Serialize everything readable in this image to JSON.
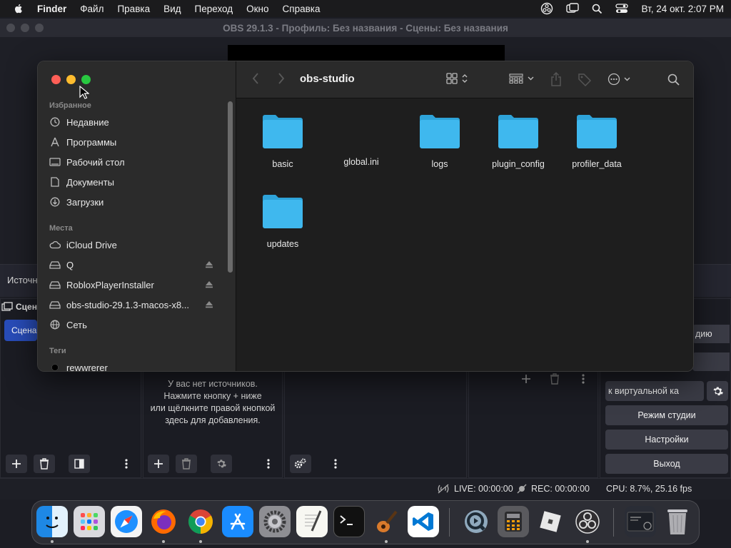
{
  "menubar": {
    "app": "Finder",
    "items": [
      "Файл",
      "Правка",
      "Вид",
      "Переход",
      "Окно",
      "Справка"
    ],
    "clock": "Вт, 24 окт.  2:07 PM"
  },
  "obs": {
    "title": "OBS 29.1.3 - Профиль: Без названия - Сцены: Без названия",
    "sources_dock_label": "Источн",
    "scenes_tab": "Сцен",
    "scene_item": "Сцена",
    "empty_sources": [
      "У вас нет источников.",
      "Нажмите кнопку + ниже",
      "или щёлкните правой кнопкой",
      "здесь для добавления."
    ],
    "controls": {
      "partial_1": "дию",
      "partial_2": "",
      "virtual_cam": "к виртуальной ка",
      "studio_mode": "Режим студии",
      "settings": "Настройки",
      "exit": "Выход"
    },
    "status": {
      "live": "LIVE: 00:00:00",
      "rec": "REC: 00:00:00",
      "cpu": "CPU: 8.7%, 25.16 fps"
    }
  },
  "finder": {
    "folder_title": "obs-studio",
    "sidebar": {
      "favorites_header": "Избранное",
      "favorites": [
        {
          "label": "Недавние",
          "icon": "clock-icon"
        },
        {
          "label": "Программы",
          "icon": "apps-icon"
        },
        {
          "label": "Рабочий стол",
          "icon": "desktop-icon"
        },
        {
          "label": "Документы",
          "icon": "document-icon"
        },
        {
          "label": "Загрузки",
          "icon": "download-icon"
        }
      ],
      "places_header": "Места",
      "places": [
        {
          "label": "iCloud Drive",
          "icon": "cloud-icon",
          "eject": false
        },
        {
          "label": "Q",
          "icon": "drive-icon",
          "eject": true
        },
        {
          "label": "RobloxPlayerInstaller",
          "icon": "drive-icon",
          "eject": true
        },
        {
          "label": "obs-studio-29.1.3-macos-x8...",
          "icon": "drive-icon",
          "eject": true
        },
        {
          "label": "Сеть",
          "icon": "network-icon",
          "eject": false
        }
      ],
      "tags_header": "Теги",
      "tags": [
        {
          "label": "rewwrerer",
          "color": "#000000"
        }
      ]
    },
    "items": [
      {
        "name": "basic",
        "kind": "folder"
      },
      {
        "name": "global.ini",
        "kind": "file"
      },
      {
        "name": "logs",
        "kind": "folder"
      },
      {
        "name": "plugin_config",
        "kind": "folder"
      },
      {
        "name": "profiler_data",
        "kind": "folder"
      },
      {
        "name": "updates",
        "kind": "folder"
      }
    ]
  },
  "colors": {
    "folder": "#3fb8ee",
    "accent": "#284cb8"
  }
}
